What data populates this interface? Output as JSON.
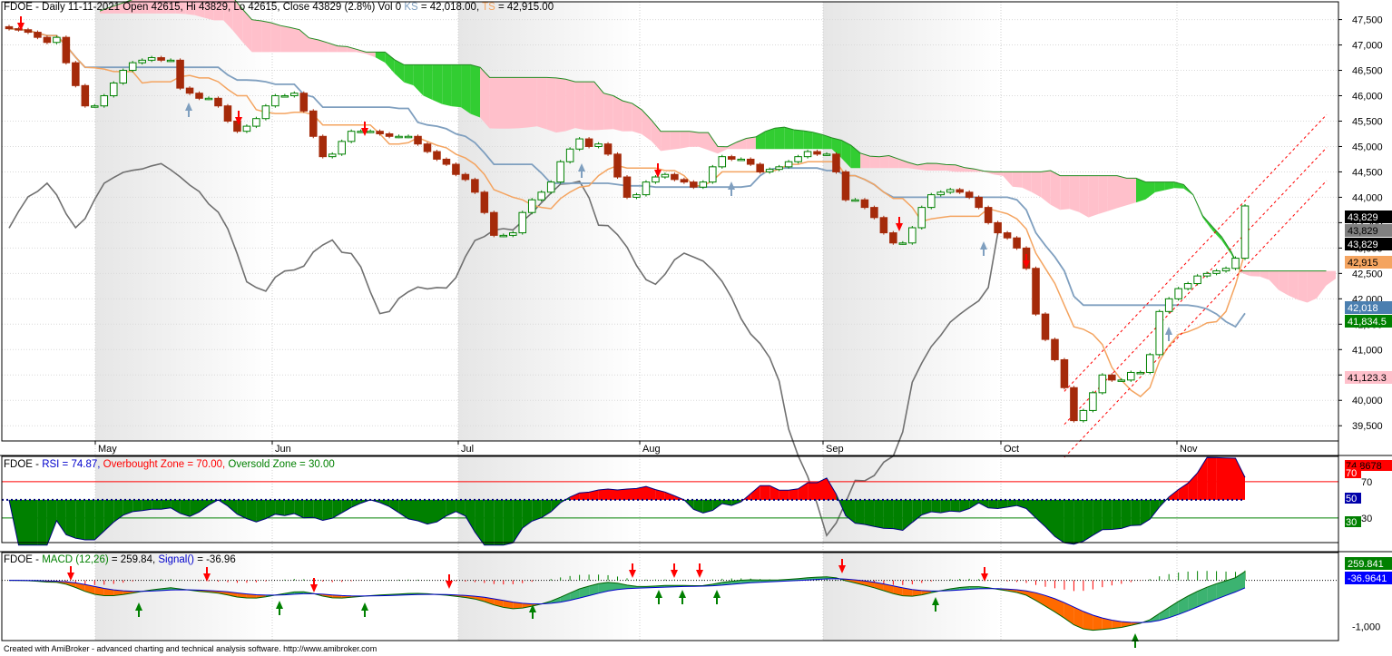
{
  "title": {
    "symbol": "FDOE",
    "info": " - Daily 11-11-2021 Open 42615, Hi 43829, Lo 42615, Close 43829 (2.8%) Vol 0 ",
    "ks_label": "KS",
    "ks_value": " = 42,018.00, ",
    "ts_label": "TS",
    "ts_value": " = 42,915.00"
  },
  "rsi_header": {
    "symbol": "FDOE",
    "sep": " - ",
    "rsi_text": "RSI = 74.87, ",
    "ob_text": "Overbought Zone = 70.00, ",
    "os_text": "Oversold Zone = 30.00"
  },
  "macd_header": {
    "symbol": "FDOE",
    "sep": " - ",
    "macd_text": "MACD (12,26)",
    "macd_value": " = 259.84, ",
    "signal_text": "Signal()",
    "signal_value": " = -36.96"
  },
  "footer": "Created with AmiBroker - advanced charting and technical analysis software. http://www.amibroker.com",
  "colors": {
    "up_candle": "#008000",
    "down_candle": "#a52a0a",
    "kijun": "#7f9fbf",
    "tenkan": "#f4a460",
    "chikou": "#707070",
    "cloud_bear": "#ffc0cb",
    "cloud_bull": "#32cd32",
    "rsi_above": "#ff0000",
    "rsi_below": "#008000",
    "macd_up": "#3cb371",
    "macd_down": "#ff6a00",
    "arrow_buy": "#008000",
    "arrow_sell": "#ff0000",
    "channel": "#ff0000"
  },
  "chart_data": [
    {
      "type": "candlestick",
      "panel": "price",
      "indicators": [
        "Ichimoku Kijun-sen (KS)",
        "Ichimoku Tenkan-sen (TS)",
        "Chikou span",
        "Ichimoku cloud",
        "Linear regression channel"
      ],
      "x_labels": [
        "May",
        "Jun",
        "Jul",
        "Aug",
        "Sep",
        "Oct",
        "Nov"
      ],
      "y_ticks": [
        39500,
        40000,
        40500,
        41000,
        41500,
        42000,
        42500,
        43000,
        43500,
        44000,
        44500,
        45000,
        45500,
        46000,
        46500,
        47000,
        47500
      ],
      "y_tick_labels": [
        "39,500",
        "40,000",
        "40,500",
        "41,000",
        "41,500",
        "42,000",
        "42,500",
        "43,000",
        "43,500",
        "44,000",
        "44,500",
        "45,000",
        "45,500",
        "46,000",
        "46,500",
        "47,000",
        "47,500"
      ],
      "ylim": [
        39200,
        47850
      ],
      "close": [
        47320,
        47300,
        47250,
        47150,
        47050,
        47150,
        46650,
        46200,
        45800,
        45800,
        46000,
        46250,
        46500,
        46650,
        46700,
        46750,
        46700,
        46700,
        46150,
        46050,
        45950,
        45950,
        45800,
        45500,
        45300,
        45400,
        45550,
        45800,
        46000,
        46000,
        46050,
        45700,
        45200,
        44800,
        44850,
        45100,
        45300,
        45300,
        45300,
        45250,
        45200,
        45200,
        45200,
        45050,
        44900,
        44750,
        44650,
        44450,
        44350,
        44100,
        43700,
        43250,
        43250,
        43300,
        43700,
        43950,
        44100,
        44300,
        44700,
        44950,
        45150,
        45000,
        45050,
        44850,
        44400,
        44000,
        44050,
        44300,
        44400,
        44450,
        44350,
        44300,
        44200,
        44300,
        44600,
        44800,
        44750,
        44750,
        44650,
        44500,
        44550,
        44600,
        44700,
        44800,
        44900,
        44850,
        44850,
        44500,
        43950,
        43950,
        43800,
        43600,
        43300,
        43100,
        43100,
        43400,
        43800,
        44050,
        44100,
        44150,
        44100,
        44000,
        43800,
        43500,
        43300,
        43200,
        43000,
        42600,
        41700,
        41200,
        40800,
        40250,
        39600,
        39800,
        40150,
        40500,
        40400,
        40400,
        40550,
        40550,
        40900,
        41750,
        42000,
        42200,
        42300,
        42450,
        42500,
        42550,
        42600,
        42800,
        43829
      ],
      "kijun_KS_last": 42018.0,
      "tenkan_TS_last": 42915.0,
      "axis_value_labels": [
        {
          "text": "43,829",
          "bg": "#000000",
          "fg": "#ffffff"
        },
        {
          "text": "43,829",
          "bg": "#808080",
          "fg": "#000000"
        },
        {
          "text": "43,829",
          "bg": "#000000",
          "fg": "#ffffff"
        },
        {
          "text": "42,915",
          "bg": "#f4a460",
          "fg": "#000000"
        },
        {
          "text": "42,018",
          "bg": "#4b7fb0",
          "fg": "#ffffff"
        },
        {
          "text": "41,834.5",
          "bg": "#008000",
          "fg": "#ffffff"
        },
        {
          "text": "41,123.3",
          "bg": "#ffc0cb",
          "fg": "#000000"
        }
      ]
    },
    {
      "type": "area",
      "panel": "rsi",
      "name": "RSI",
      "overbought": 70,
      "oversold": 30,
      "last": 74.87,
      "y_ticks": [
        30,
        70
      ],
      "axis_value_labels": [
        {
          "text": "74.8678",
          "bg": "#ff0000",
          "fg": "#000000"
        },
        {
          "text": "70",
          "bg": "#ff0000",
          "fg": "#ffffff"
        },
        {
          "text": "50",
          "bg": "#0000aa",
          "fg": "#ffffff"
        },
        {
          "text": "30",
          "bg": "#008000",
          "fg": "#ffffff"
        }
      ]
    },
    {
      "type": "line",
      "panel": "macd",
      "name": "MACD (12,26)",
      "macd_last": 259.84,
      "signal_last": -36.96,
      "y_ticks": [
        -1000
      ],
      "y_tick_labels": [
        "-1,000"
      ],
      "axis_value_labels": [
        {
          "text": "259.841",
          "bg": "#008000",
          "fg": "#ffffff"
        },
        {
          "text": "-36.9641",
          "bg": "#0000ff",
          "fg": "#ffffff"
        }
      ]
    }
  ]
}
